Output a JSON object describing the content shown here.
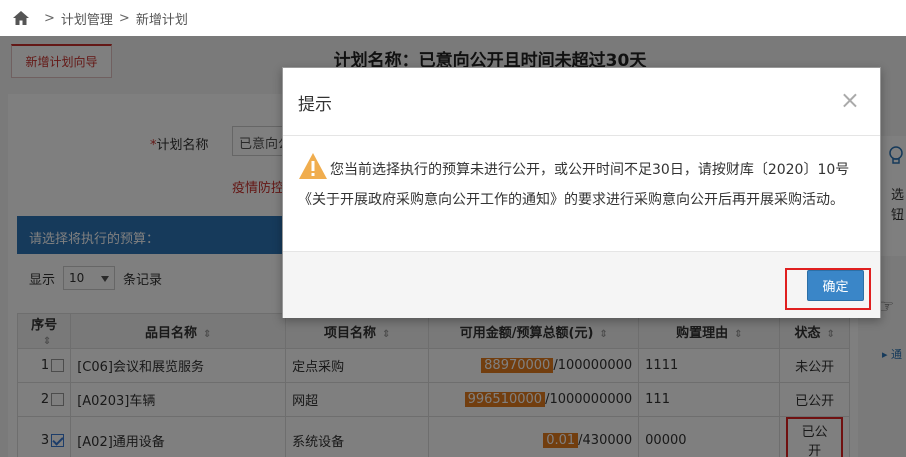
{
  "breadcrumb": {
    "items": [
      "计划管理",
      "新增计划"
    ],
    "separator": ">"
  },
  "tab": {
    "label": "新增计划向导"
  },
  "plan_heading": "计划名称：已意向公开且时间未超过30天",
  "form": {
    "name_label": "计划名称",
    "name_required": "*",
    "name_value": "已意向公",
    "red_note": "疫情防控"
  },
  "budget_section": {
    "title": "请选择将执行的预算：",
    "show_prefix": "显示",
    "page_length": "10",
    "show_suffix": "条记录"
  },
  "table": {
    "headers": [
      "序号",
      "品目名称",
      "项目名称",
      "可用金额/预算总额(元)",
      "购置理由",
      "状态"
    ],
    "rows": [
      {
        "index": "1",
        "checked": false,
        "item": "[C06]会议和展览服务",
        "project": "定点采购",
        "available": "88970000",
        "total": "/100000000",
        "reason": "1111",
        "status": "未公开"
      },
      {
        "index": "2",
        "checked": false,
        "item": "[A0203]车辆",
        "project": "网超",
        "available": "996510000",
        "total": "/1000000000",
        "reason": "111",
        "status": "已公开"
      },
      {
        "index": "3",
        "checked": true,
        "item": "[A02]通用设备",
        "project": "系统设备",
        "available": "0.01",
        "total": "/430000",
        "reason": "00000",
        "status": "已公开"
      }
    ]
  },
  "right_panel": {
    "text": "选\n钮",
    "link_prefix": "▸ 通"
  },
  "modal": {
    "title": "提示",
    "close": "×",
    "message": "您当前选择执行的预算未进行公开，或公开时间不足30日，请按财库〔2020〕10号《关于开展政府采购意向公开工作的通知》的要求进行采购意向公开后再开展采购活动。",
    "confirm_label": "确定"
  },
  "colors": {
    "accent_red": "#c9302c",
    "primary_blue": "#2c74b6",
    "button_blue": "#3a86c8",
    "amount_orange": "#e57c1e",
    "warning_orange": "#f0ad4e"
  }
}
